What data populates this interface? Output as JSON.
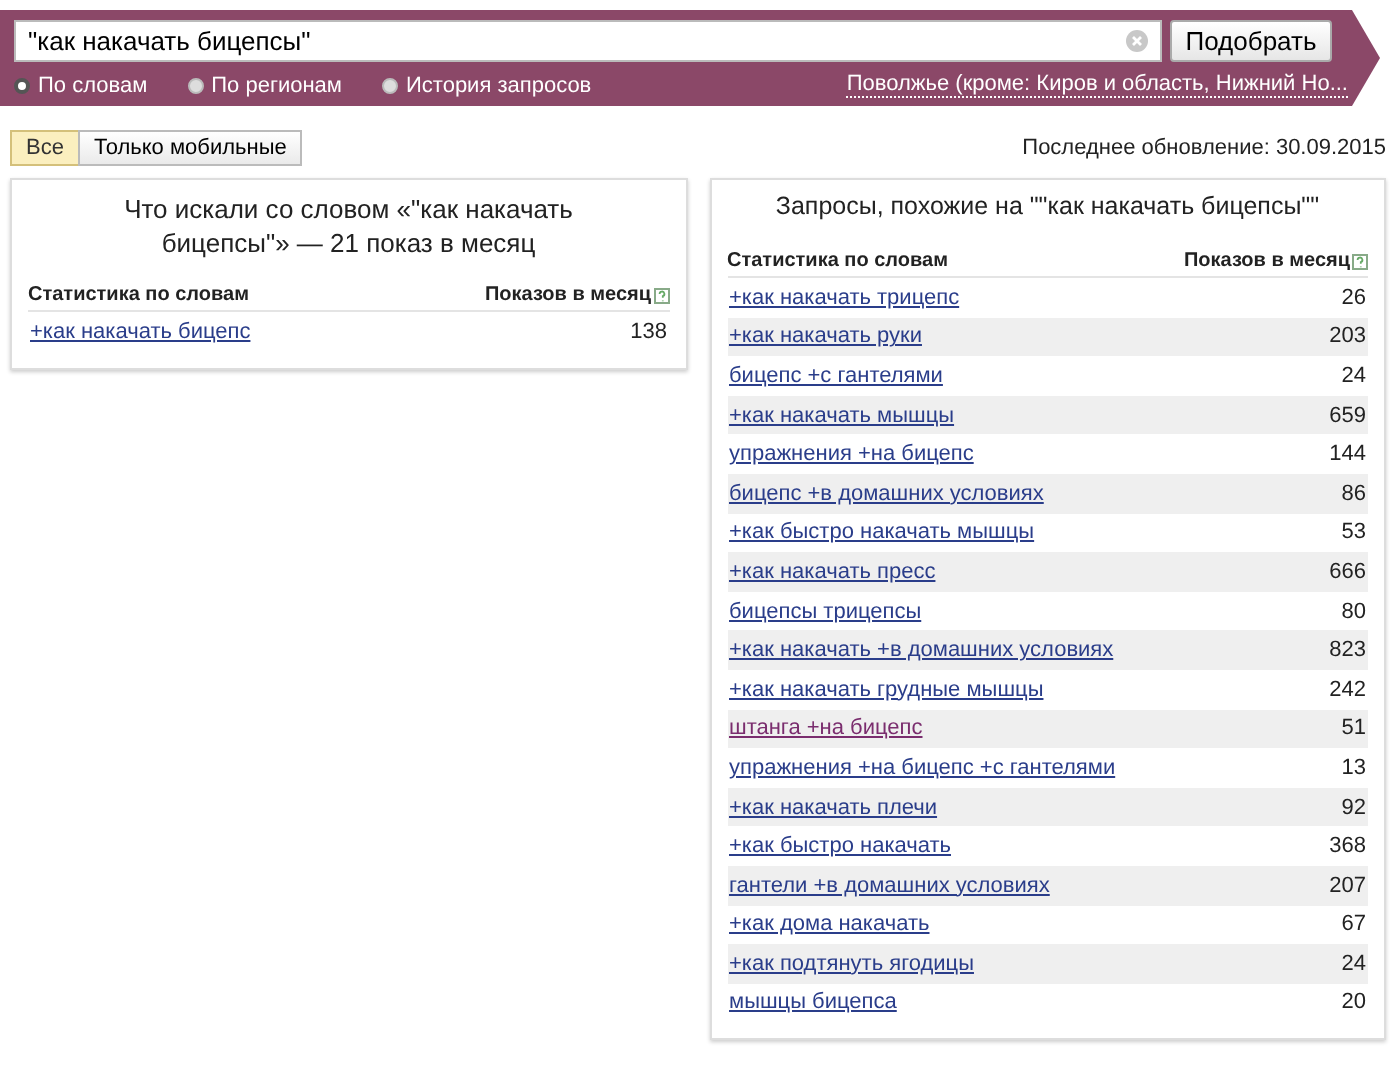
{
  "search": {
    "value": "\"как накачать бицепсы\"",
    "button": "Подобрать"
  },
  "modes": [
    {
      "label": "По словам",
      "selected": true
    },
    {
      "label": "По регионам",
      "selected": false
    },
    {
      "label": "История запросов",
      "selected": false
    }
  ],
  "region": "Поволжье (кроме: Киров и область, Нижний Но...",
  "filters": [
    {
      "label": "Все",
      "selected": true
    },
    {
      "label": "Только мобильные",
      "selected": false
    }
  ],
  "last_update": "Последнее обновление: 30.09.2015",
  "panels": [
    {
      "title": "Что искали со словом «\"как накачать бицепсы\"» — 21 показ в месяц",
      "columns": [
        "Статистика по словам",
        "Показов в месяц"
      ],
      "rows": [
        {
          "phrase": "+как накачать бицепс",
          "count": "138",
          "visited": false
        }
      ]
    },
    {
      "title": "Запросы, похожие на \"\"как накачать бицепсы\"\"",
      "columns": [
        "Статистика по словам",
        "Показов в месяц"
      ],
      "rows": [
        {
          "phrase": "+как накачать трицепс",
          "count": "26",
          "visited": false
        },
        {
          "phrase": "+как накачать руки",
          "count": "203",
          "visited": false
        },
        {
          "phrase": "бицепс +с гантелями",
          "count": "24",
          "visited": false
        },
        {
          "phrase": "+как накачать мышцы",
          "count": "659",
          "visited": false
        },
        {
          "phrase": "упражнения +на бицепс",
          "count": "144",
          "visited": false
        },
        {
          "phrase": "бицепс +в домашних условиях",
          "count": "86",
          "visited": false
        },
        {
          "phrase": "+как быстро накачать мышцы",
          "count": "53",
          "visited": false
        },
        {
          "phrase": "+как накачать пресс",
          "count": "666",
          "visited": false
        },
        {
          "phrase": "бицепсы трицепсы",
          "count": "80",
          "visited": false
        },
        {
          "phrase": "+как накачать +в домашних условиях",
          "count": "823",
          "visited": false
        },
        {
          "phrase": "+как накачать грудные мышцы",
          "count": "242",
          "visited": false
        },
        {
          "phrase": "штанга +на бицепс",
          "count": "51",
          "visited": true
        },
        {
          "phrase": "упражнения +на бицепс +с гантелями",
          "count": "13",
          "visited": false
        },
        {
          "phrase": "+как накачать плечи",
          "count": "92",
          "visited": false
        },
        {
          "phrase": "+как быстро накачать",
          "count": "368",
          "visited": false
        },
        {
          "phrase": "гантели +в домашних условиях",
          "count": "207",
          "visited": false
        },
        {
          "phrase": "+как дома накачать",
          "count": "67",
          "visited": false
        },
        {
          "phrase": "+как подтянуть ягодицы",
          "count": "24",
          "visited": false
        },
        {
          "phrase": "мышцы бицепса",
          "count": "20",
          "visited": false
        }
      ]
    }
  ]
}
